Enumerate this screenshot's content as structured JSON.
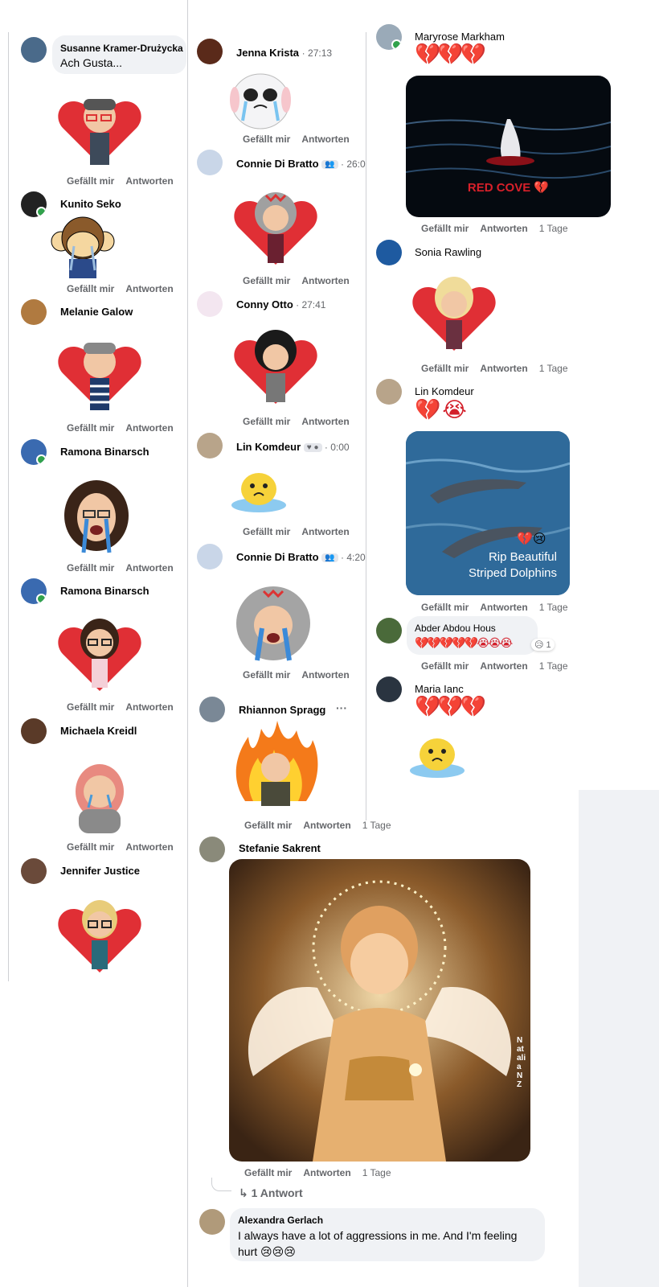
{
  "labels": {
    "like": "Gefällt mir",
    "reply": "Antworten"
  },
  "col1": {
    "first": {
      "name": "Susanne Kramer-Drużycka",
      "text": "Ach Gusta..."
    },
    "comments": [
      {
        "name": "Kunito Seko"
      },
      {
        "name": "Melanie Galow"
      },
      {
        "name": "Ramona Binarsch"
      },
      {
        "name": "Ramona Binarsch"
      },
      {
        "name": "Michaela Kreidl"
      },
      {
        "name": "Jennifer Justice"
      }
    ]
  },
  "col2": {
    "comments": [
      {
        "name": "Jenna Krista",
        "time": "27:13"
      },
      {
        "name": "Connie Di Bratto",
        "time": "26:0"
      },
      {
        "name": "Conny Otto",
        "time": "27:41"
      },
      {
        "name": "Lin Komdeur",
        "time": "0:00"
      },
      {
        "name": "Connie Di Bratto",
        "time": "4:20"
      },
      {
        "name": "Rhiannon Spragg",
        "more": "···",
        "ago": "1 Tage"
      }
    ],
    "stefanie": {
      "name": "Stefanie Sakrent",
      "ago": "1 Tage",
      "watermark": "Natalia NZ",
      "replies": "1 Antwort"
    },
    "alexandra": {
      "name": "Alexandra Gerlach",
      "text": "I always have a lot of aggressions in me. And I'm feeling hurt 😢😢😢"
    }
  },
  "col3": {
    "maryrose": {
      "name": "Maryrose Markham",
      "emoji": "💔💔💔",
      "img_text": "RED COVE 💔",
      "ago": "1 Tage"
    },
    "sonia": {
      "name": "Sonia Rawling",
      "ago": "1 Tage"
    },
    "lin": {
      "name": "Lin Komdeur",
      "emoji": "💔😭",
      "img_text1": "Rip Beautiful",
      "img_text2": "Striped Dolphins",
      "img_emoji": "💔😢",
      "ago": "1 Tage"
    },
    "abder": {
      "name": "Abder Abdou Hous",
      "text": "💔💔💔💔💔😭😭😭",
      "reaction": "😥 1",
      "ago": "1 Tage"
    },
    "maria": {
      "name": "Maria Ianc",
      "emoji": "💔💔💔"
    }
  },
  "colors": {
    "accent": "#1877f2",
    "online": "#31a24c",
    "bubble": "#f0f2f5",
    "secondary": "#65676b"
  }
}
